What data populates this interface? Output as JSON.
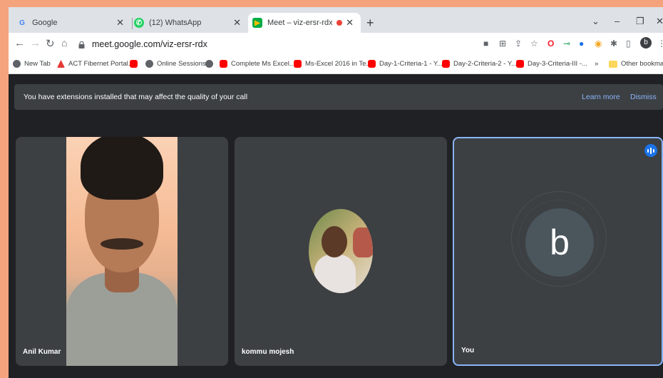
{
  "browser": {
    "tabs": [
      {
        "title": "Google",
        "icon": "google-icon"
      },
      {
        "title": "(12) WhatsApp",
        "icon": "whatsapp-icon"
      },
      {
        "title": "Meet – viz-ersr-rdx",
        "icon": "meet-icon",
        "active": true,
        "recording": true
      }
    ],
    "url": "meet.google.com/viz-ersr-rdx",
    "bookmarks": [
      {
        "label": "New Tab",
        "icon": "globe-icon"
      },
      {
        "label": "ACT Fibernet Portal...",
        "icon": "act-icon"
      },
      {
        "label": "",
        "icon": "youtube-icon"
      },
      {
        "label": "Online Sessions",
        "icon": "globe-icon"
      },
      {
        "label": "",
        "icon": "globe-icon"
      },
      {
        "label": "Complete Ms Excel...",
        "icon": "youtube-icon"
      },
      {
        "label": "Ms-Excel 2016 in Te...",
        "icon": "youtube-icon"
      },
      {
        "label": "Day-1-Criteria-1 - Y...",
        "icon": "youtube-icon"
      },
      {
        "label": "Day-2-Criteria-2 - Y...",
        "icon": "youtube-icon"
      },
      {
        "label": "Day-3-Criteria-III -...",
        "icon": "youtube-icon"
      },
      {
        "label": "»",
        "icon": ""
      },
      {
        "label": "Other bookmarks",
        "icon": "folder-icon"
      }
    ],
    "profile_initial": "b"
  },
  "banner": {
    "text": "You have extensions installed that may affect the quality of your call",
    "learn_more": "Learn more",
    "dismiss": "Dismiss"
  },
  "participants": [
    {
      "name": "Anil Kumar",
      "mode": "video"
    },
    {
      "name": "kommu mojesh",
      "mode": "avatar-photo"
    },
    {
      "name": "You",
      "mode": "avatar-initial",
      "initial": "b",
      "speaking": true
    }
  ],
  "colors": {
    "accent": "#8ab4f8",
    "meet_bg": "#202124",
    "tile_bg": "#3c4043",
    "frame": "#f4a37c"
  }
}
